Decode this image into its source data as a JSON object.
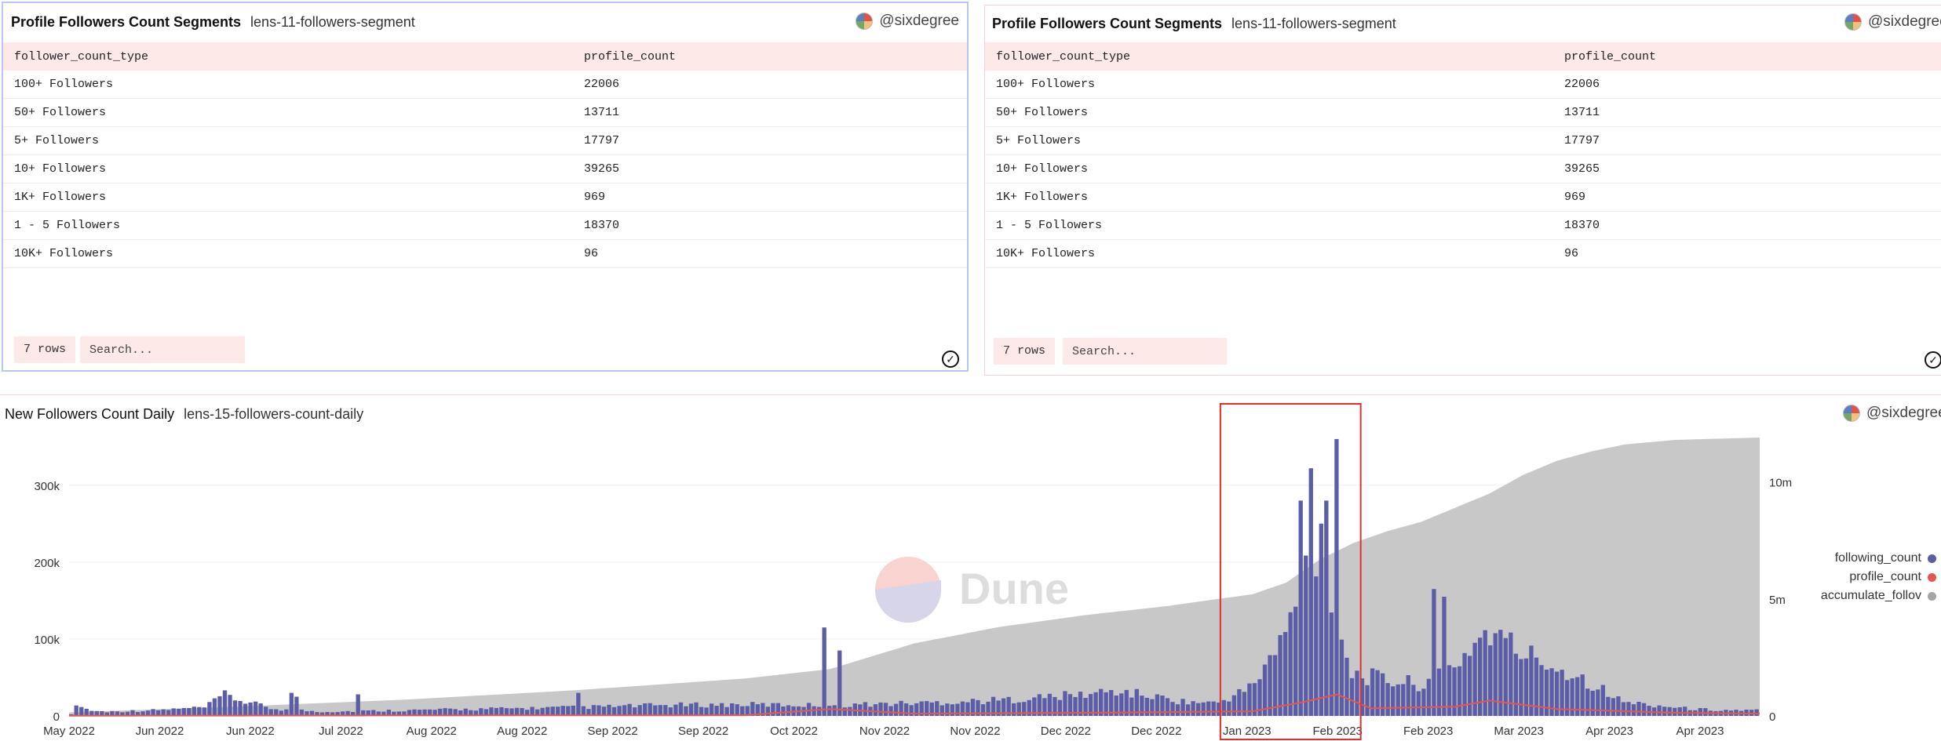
{
  "panel_a": {
    "title": "Profile Followers Count Segments",
    "subtitle": "lens-11-followers-segment",
    "owner": "@sixdegree",
    "columns": [
      "follower_count_type",
      "profile_count"
    ],
    "rows": [
      [
        "100+ Followers",
        "22006"
      ],
      [
        "50+ Followers",
        "13711"
      ],
      [
        "5+ Followers",
        "17797"
      ],
      [
        "10+ Followers",
        "39265"
      ],
      [
        "1K+ Followers",
        "969"
      ],
      [
        "1 - 5 Followers",
        "18370"
      ],
      [
        "10K+ Followers",
        "96"
      ]
    ],
    "rows_label": "7 rows",
    "search_placeholder": "Search..."
  },
  "panel_b": {
    "title": "Profile Followers Count Segments",
    "subtitle": "lens-11-followers-segment",
    "owner": "@sixdegree",
    "columns": [
      "follower_count_type",
      "profile_count"
    ],
    "rows": [
      [
        "100+ Followers",
        "22006"
      ],
      [
        "50+ Followers",
        "13711"
      ],
      [
        "5+ Followers",
        "17797"
      ],
      [
        "10+ Followers",
        "39265"
      ],
      [
        "1K+ Followers",
        "969"
      ],
      [
        "1 - 5 Followers",
        "18370"
      ],
      [
        "10K+ Followers",
        "96"
      ]
    ],
    "rows_label": "7 rows",
    "search_placeholder": "Search..."
  },
  "panel_c": {
    "title": "New Followers Count Daily",
    "subtitle": "lens-15-followers-count-daily",
    "owner": "@sixdegree",
    "watermark": "Dune"
  },
  "chart_data": {
    "type": "bar",
    "x_tick_labels": [
      "May 2022",
      "Jun 2022",
      "Jun 2022",
      "Jul 2022",
      "Aug 2022",
      "Aug 2022",
      "Sep 2022",
      "Sep 2022",
      "Oct 2022",
      "Nov 2022",
      "Nov 2022",
      "Dec 2022",
      "Dec 2022",
      "Jan 2023",
      "Feb 2023",
      "Feb 2023",
      "Mar 2023",
      "Apr 2023",
      "Apr 2023"
    ],
    "y_left_ticks": [
      "0",
      "100k",
      "200k",
      "300k"
    ],
    "y_left_values": [
      0,
      100000,
      200000,
      300000
    ],
    "y_left_max": 365000,
    "y_right_ticks": [
      "0",
      "5m",
      "10m"
    ],
    "y_right_values": [
      0,
      5000000,
      10000000
    ],
    "y_right_max": 12000000,
    "legend_position": "right",
    "highlight_range": [
      0.681,
      0.764
    ],
    "series": [
      {
        "name": "following_count",
        "color": "#5b5ea6",
        "anchors": [
          [
            0,
            3000
          ],
          [
            0.005,
            18000
          ],
          [
            0.01,
            8000
          ],
          [
            0.02,
            6000
          ],
          [
            0.05,
            8000
          ],
          [
            0.08,
            12000
          ],
          [
            0.09,
            30000
          ],
          [
            0.1,
            22000
          ],
          [
            0.12,
            10000
          ],
          [
            0.15,
            6000
          ],
          [
            0.2,
            8000
          ],
          [
            0.25,
            10000
          ],
          [
            0.3,
            12000
          ],
          [
            0.35,
            15000
          ],
          [
            0.4,
            16000
          ],
          [
            0.45,
            15000
          ],
          [
            0.5,
            18000
          ],
          [
            0.55,
            22000
          ],
          [
            0.6,
            30000
          ],
          [
            0.62,
            35000
          ],
          [
            0.64,
            28000
          ],
          [
            0.66,
            20000
          ],
          [
            0.68,
            18000
          ],
          [
            0.7,
            40000
          ],
          [
            0.72,
            110000
          ],
          [
            0.73,
            190000
          ],
          [
            0.74,
            250000
          ],
          [
            0.75,
            140000
          ],
          [
            0.76,
            60000
          ],
          [
            0.78,
            50000
          ],
          [
            0.8,
            45000
          ],
          [
            0.82,
            70000
          ],
          [
            0.84,
            120000
          ],
          [
            0.86,
            90000
          ],
          [
            0.88,
            70000
          ],
          [
            0.9,
            50000
          ],
          [
            0.92,
            20000
          ],
          [
            0.94,
            15000
          ],
          [
            0.96,
            10000
          ],
          [
            0.98,
            8000
          ],
          [
            1,
            8000
          ]
        ],
        "spikes": [
          [
            0.131,
            30000
          ],
          [
            0.134,
            25000
          ],
          [
            0.17,
            28000
          ],
          [
            0.447,
            115000
          ],
          [
            0.455,
            85000
          ],
          [
            0.728,
            280000
          ],
          [
            0.735,
            322000
          ],
          [
            0.742,
            250000
          ],
          [
            0.746,
            280000
          ],
          [
            0.751,
            360000
          ],
          [
            0.81,
            165000
          ],
          [
            0.815,
            155000
          ],
          [
            0.3,
            30000
          ]
        ]
      },
      {
        "name": "profile_count",
        "color": "#e8554a",
        "anchors": [
          [
            0,
            300
          ],
          [
            0.2,
            600
          ],
          [
            0.4,
            900
          ],
          [
            0.45,
            9000
          ],
          [
            0.5,
            3000
          ],
          [
            0.6,
            4000
          ],
          [
            0.7,
            6000
          ],
          [
            0.73,
            18000
          ],
          [
            0.75,
            28000
          ],
          [
            0.77,
            10000
          ],
          [
            0.82,
            12000
          ],
          [
            0.84,
            20000
          ],
          [
            0.88,
            9000
          ],
          [
            0.95,
            4000
          ],
          [
            1,
            3000
          ]
        ]
      },
      {
        "name": "accumulate_follov",
        "color": "#a5a5a5",
        "anchors": [
          [
            0,
            0.15
          ],
          [
            0.1,
            0.4
          ],
          [
            0.2,
            0.7
          ],
          [
            0.3,
            1.1
          ],
          [
            0.4,
            1.6
          ],
          [
            0.45,
            2.0
          ],
          [
            0.5,
            3.1
          ],
          [
            0.55,
            3.8
          ],
          [
            0.6,
            4.3
          ],
          [
            0.65,
            4.7
          ],
          [
            0.7,
            5.2
          ],
          [
            0.72,
            5.7
          ],
          [
            0.74,
            6.7
          ],
          [
            0.76,
            7.4
          ],
          [
            0.78,
            7.9
          ],
          [
            0.8,
            8.3
          ],
          [
            0.82,
            8.9
          ],
          [
            0.84,
            9.5
          ],
          [
            0.86,
            10.3
          ],
          [
            0.88,
            10.9
          ],
          [
            0.9,
            11.3
          ],
          [
            0.92,
            11.6
          ],
          [
            0.95,
            11.8
          ],
          [
            1,
            11.9
          ]
        ]
      }
    ]
  }
}
